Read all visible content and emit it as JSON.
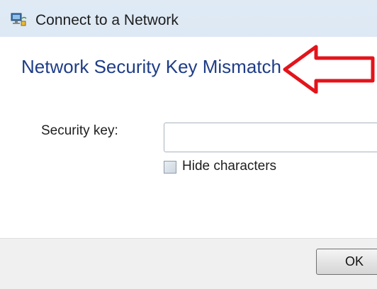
{
  "window": {
    "title": "Connect to a Network",
    "icon": "network-icon"
  },
  "dialog": {
    "heading": "Network Security Key Mismatch",
    "security_key_label": "Security key:",
    "security_key_value": "",
    "hide_characters_label": "Hide characters",
    "hide_characters_checked": false,
    "ok_label": "OK"
  },
  "annotation": {
    "arrow_icon": "red-arrow-icon",
    "arrow_color": "#e3141b"
  },
  "colors": {
    "heading": "#1f3d87",
    "frame": "#cfdfee",
    "footer": "#f0f0f0"
  }
}
